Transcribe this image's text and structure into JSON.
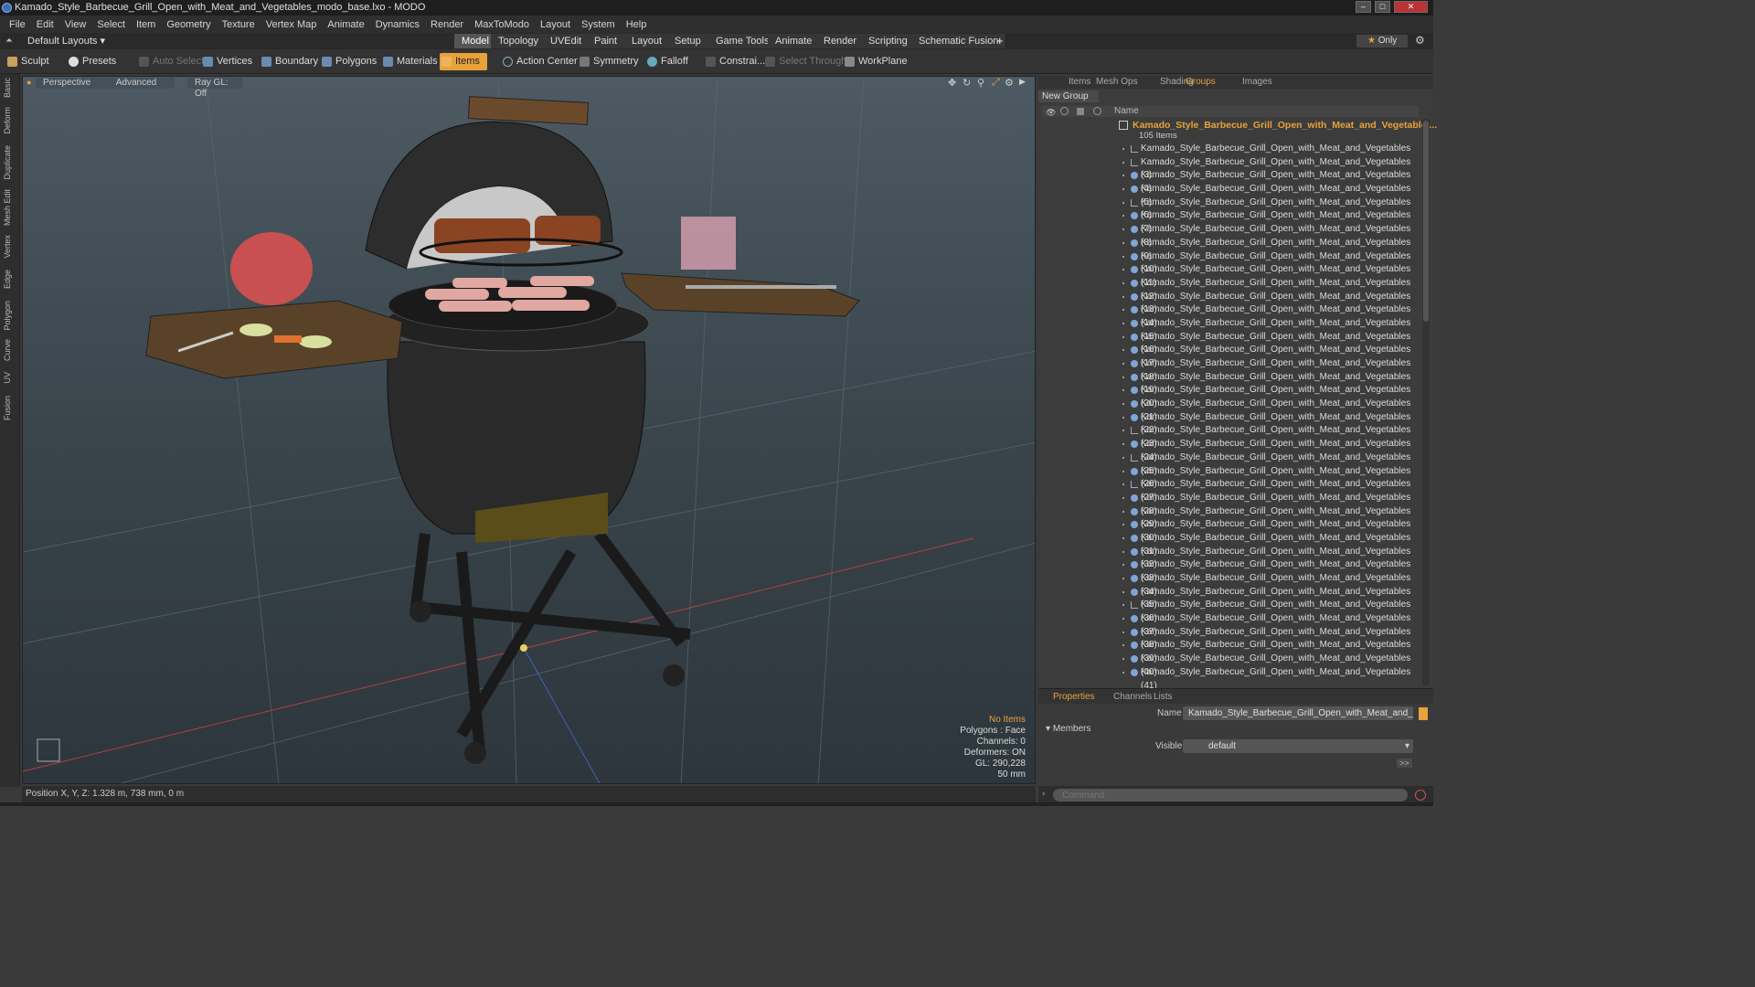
{
  "title": "Kamado_Style_Barbecue_Grill_Open_with_Meat_and_Vegetables_modo_base.lxo - MODO",
  "menu": [
    "File",
    "Edit",
    "View",
    "Select",
    "Item",
    "Geometry",
    "Texture",
    "Vertex Map",
    "Animate",
    "Dynamics",
    "Render",
    "MaxToModo",
    "Layout",
    "System",
    "Help"
  ],
  "layout_selector": "Default Layouts",
  "layout_tabs": [
    "Model",
    "Topology",
    "UVEdit",
    "Paint",
    "Layout",
    "Setup",
    "Game Tools",
    "Animate",
    "Render",
    "Scripting",
    "Schematic Fusion"
  ],
  "layout_add": "+",
  "only_label": "Only",
  "toolbar": {
    "sculpt": "Sculpt",
    "presets": "Presets",
    "auto_select": "Auto Select",
    "vertices": "Vertices",
    "boundary": "Boundary",
    "polygons": "Polygons",
    "materials": "Materials",
    "items": "Items",
    "action_center": "Action Center",
    "symmetry": "Symmetry",
    "falloff": "Falloff",
    "constraints": "Constrai...",
    "select_through": "Select Through",
    "workplane": "WorkPlane"
  },
  "left_tabs": [
    "Basic",
    "Deform",
    "Duplicate",
    "Mesh Edit",
    "Vertex",
    "Edge",
    "Polygon",
    "Curve",
    "UV",
    "Fusion"
  ],
  "viewport": {
    "view": "Perspective",
    "shading": "Advanced",
    "raygl": "Ray GL: Off",
    "info": {
      "items": "No Items",
      "polygons": "Polygons : Face",
      "channels": "Channels: 0",
      "deformers": "Deformers: ON",
      "gl": "GL: 290,228",
      "lens": "50 mm"
    }
  },
  "status": "Position X, Y, Z:  1.328 m, 738 mm, 0 m",
  "right_panel": {
    "tabs": [
      "Items",
      "Mesh Ops",
      "Shading",
      "Groups",
      "Images"
    ],
    "active_tab": "Groups",
    "new_group": "New Group",
    "col_name": "Name",
    "group_name": "Kamado_Style_Barbecue_Grill_Open_with_Meat_and_Vegetable ...",
    "group_count": "105 Items",
    "items": [
      {
        "name": "Kamado_Style_Barbecue_Grill_Open_with_Meat_and_Vegetables",
        "icon": "locator-icon"
      },
      {
        "name": "Kamado_Style_Barbecue_Grill_Open_with_Meat_and_Vegetables (3)",
        "icon": "locator-icon"
      },
      {
        "name": "Kamado_Style_Barbecue_Grill_Open_with_Meat_and_Vegetables (4)",
        "icon": "mesh-icon"
      },
      {
        "name": "Kamado_Style_Barbecue_Grill_Open_with_Meat_and_Vegetables (5)",
        "icon": "mesh-icon"
      },
      {
        "name": "Kamado_Style_Barbecue_Grill_Open_with_Meat_and_Vegetables (6)",
        "icon": "locator-icon"
      },
      {
        "name": "Kamado_Style_Barbecue_Grill_Open_with_Meat_and_Vegetables (7)",
        "icon": "mesh-icon"
      },
      {
        "name": "Kamado_Style_Barbecue_Grill_Open_with_Meat_and_Vegetables (8)",
        "icon": "mesh-icon"
      },
      {
        "name": "Kamado_Style_Barbecue_Grill_Open_with_Meat_and_Vegetables (9)",
        "icon": "mesh-icon"
      },
      {
        "name": "Kamado_Style_Barbecue_Grill_Open_with_Meat_and_Vegetables (10)",
        "icon": "mesh-icon"
      },
      {
        "name": "Kamado_Style_Barbecue_Grill_Open_with_Meat_and_Vegetables (11)",
        "icon": "mesh-icon"
      },
      {
        "name": "Kamado_Style_Barbecue_Grill_Open_with_Meat_and_Vegetables (12)",
        "icon": "mesh-icon"
      },
      {
        "name": "Kamado_Style_Barbecue_Grill_Open_with_Meat_and_Vegetables (13)",
        "icon": "mesh-icon"
      },
      {
        "name": "Kamado_Style_Barbecue_Grill_Open_with_Meat_and_Vegetables (14)",
        "icon": "mesh-icon"
      },
      {
        "name": "Kamado_Style_Barbecue_Grill_Open_with_Meat_and_Vegetables (15)",
        "icon": "mesh-icon"
      },
      {
        "name": "Kamado_Style_Barbecue_Grill_Open_with_Meat_and_Vegetables (16)",
        "icon": "mesh-icon"
      },
      {
        "name": "Kamado_Style_Barbecue_Grill_Open_with_Meat_and_Vegetables (17)",
        "icon": "mesh-icon"
      },
      {
        "name": "Kamado_Style_Barbecue_Grill_Open_with_Meat_and_Vegetables (18)",
        "icon": "mesh-icon"
      },
      {
        "name": "Kamado_Style_Barbecue_Grill_Open_with_Meat_and_Vegetables (19)",
        "icon": "mesh-icon"
      },
      {
        "name": "Kamado_Style_Barbecue_Grill_Open_with_Meat_and_Vegetables (20)",
        "icon": "mesh-icon"
      },
      {
        "name": "Kamado_Style_Barbecue_Grill_Open_with_Meat_and_Vegetables (21)",
        "icon": "mesh-icon"
      },
      {
        "name": "Kamado_Style_Barbecue_Grill_Open_with_Meat_and_Vegetables (22)",
        "icon": "mesh-icon"
      },
      {
        "name": "Kamado_Style_Barbecue_Grill_Open_with_Meat_and_Vegetables (23)",
        "icon": "locator-icon"
      },
      {
        "name": "Kamado_Style_Barbecue_Grill_Open_with_Meat_and_Vegetables (24)",
        "icon": "mesh-icon"
      },
      {
        "name": "Kamado_Style_Barbecue_Grill_Open_with_Meat_and_Vegetables (25)",
        "icon": "locator-icon"
      },
      {
        "name": "Kamado_Style_Barbecue_Grill_Open_with_Meat_and_Vegetables (26)",
        "icon": "mesh-icon"
      },
      {
        "name": "Kamado_Style_Barbecue_Grill_Open_with_Meat_and_Vegetables (27)",
        "icon": "locator-icon"
      },
      {
        "name": "Kamado_Style_Barbecue_Grill_Open_with_Meat_and_Vegetables (28)",
        "icon": "mesh-icon"
      },
      {
        "name": "Kamado_Style_Barbecue_Grill_Open_with_Meat_and_Vegetables (29)",
        "icon": "mesh-icon"
      },
      {
        "name": "Kamado_Style_Barbecue_Grill_Open_with_Meat_and_Vegetables (30)",
        "icon": "mesh-icon"
      },
      {
        "name": "Kamado_Style_Barbecue_Grill_Open_with_Meat_and_Vegetables (31)",
        "icon": "mesh-icon"
      },
      {
        "name": "Kamado_Style_Barbecue_Grill_Open_with_Meat_and_Vegetables (32)",
        "icon": "mesh-icon"
      },
      {
        "name": "Kamado_Style_Barbecue_Grill_Open_with_Meat_and_Vegetables (33)",
        "icon": "mesh-icon"
      },
      {
        "name": "Kamado_Style_Barbecue_Grill_Open_with_Meat_and_Vegetables (34)",
        "icon": "mesh-icon"
      },
      {
        "name": "Kamado_Style_Barbecue_Grill_Open_with_Meat_and_Vegetables (35)",
        "icon": "mesh-icon"
      },
      {
        "name": "Kamado_Style_Barbecue_Grill_Open_with_Meat_and_Vegetables (36)",
        "icon": "locator-icon"
      },
      {
        "name": "Kamado_Style_Barbecue_Grill_Open_with_Meat_and_Vegetables (37)",
        "icon": "mesh-icon"
      },
      {
        "name": "Kamado_Style_Barbecue_Grill_Open_with_Meat_and_Vegetables (38)",
        "icon": "mesh-icon"
      },
      {
        "name": "Kamado_Style_Barbecue_Grill_Open_with_Meat_and_Vegetables (39)",
        "icon": "mesh-icon"
      },
      {
        "name": "Kamado_Style_Barbecue_Grill_Open_with_Meat_and_Vegetables (40)",
        "icon": "mesh-icon"
      },
      {
        "name": "Kamado_Style_Barbecue_Grill_Open_with_Meat_and_Vegetables (41)",
        "icon": "mesh-icon"
      }
    ]
  },
  "properties": {
    "tabs": [
      "Properties",
      "Channels",
      "Lists"
    ],
    "active_tab": "Properties",
    "name_label": "Name",
    "name_value": "Kamado_Style_Barbecue_Grill_Open_with_Meat_and_Vegetab",
    "members": "Members",
    "visible_label": "Visible",
    "visible_value": "default",
    "more": ">>"
  },
  "command_placeholder": "Command",
  "colors": {
    "accent": "#e8a23a",
    "viewport_top": "#4d5a63",
    "viewport_bottom": "#2d363c"
  }
}
